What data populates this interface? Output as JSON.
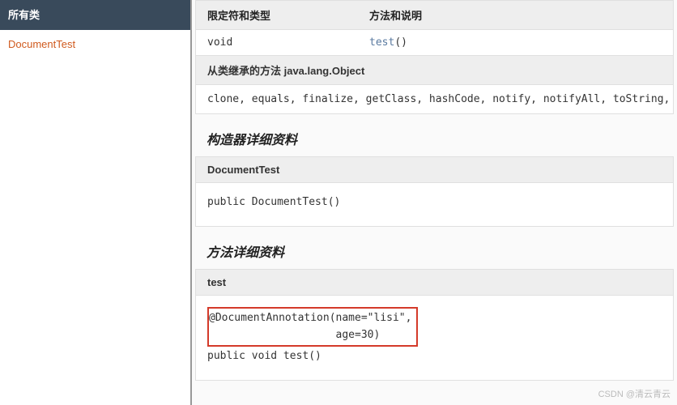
{
  "sidebar": {
    "title": "所有类",
    "link_label": "DocumentTest"
  },
  "method_summary": {
    "col_a": "限定符和类型",
    "col_b": "方法和说明",
    "row_type": "void",
    "row_method": "test",
    "row_parens": "()",
    "inherited_title": "从类继承的方法 java.lang.Object",
    "inherited_list": "clone, equals, finalize, getClass, hashCode, notify, notifyAll, toString, w"
  },
  "ctor_detail": {
    "title": "构造器详细资料",
    "name": "DocumentTest",
    "signature": "public DocumentTest()"
  },
  "method_detail": {
    "title": "方法详细资料",
    "name": "test",
    "annotation_l1": "@DocumentAnnotation(name=\"lisi\",",
    "annotation_l2": "                    age=30)",
    "signature": "public void test()"
  },
  "watermark": "CSDN @清云青云"
}
